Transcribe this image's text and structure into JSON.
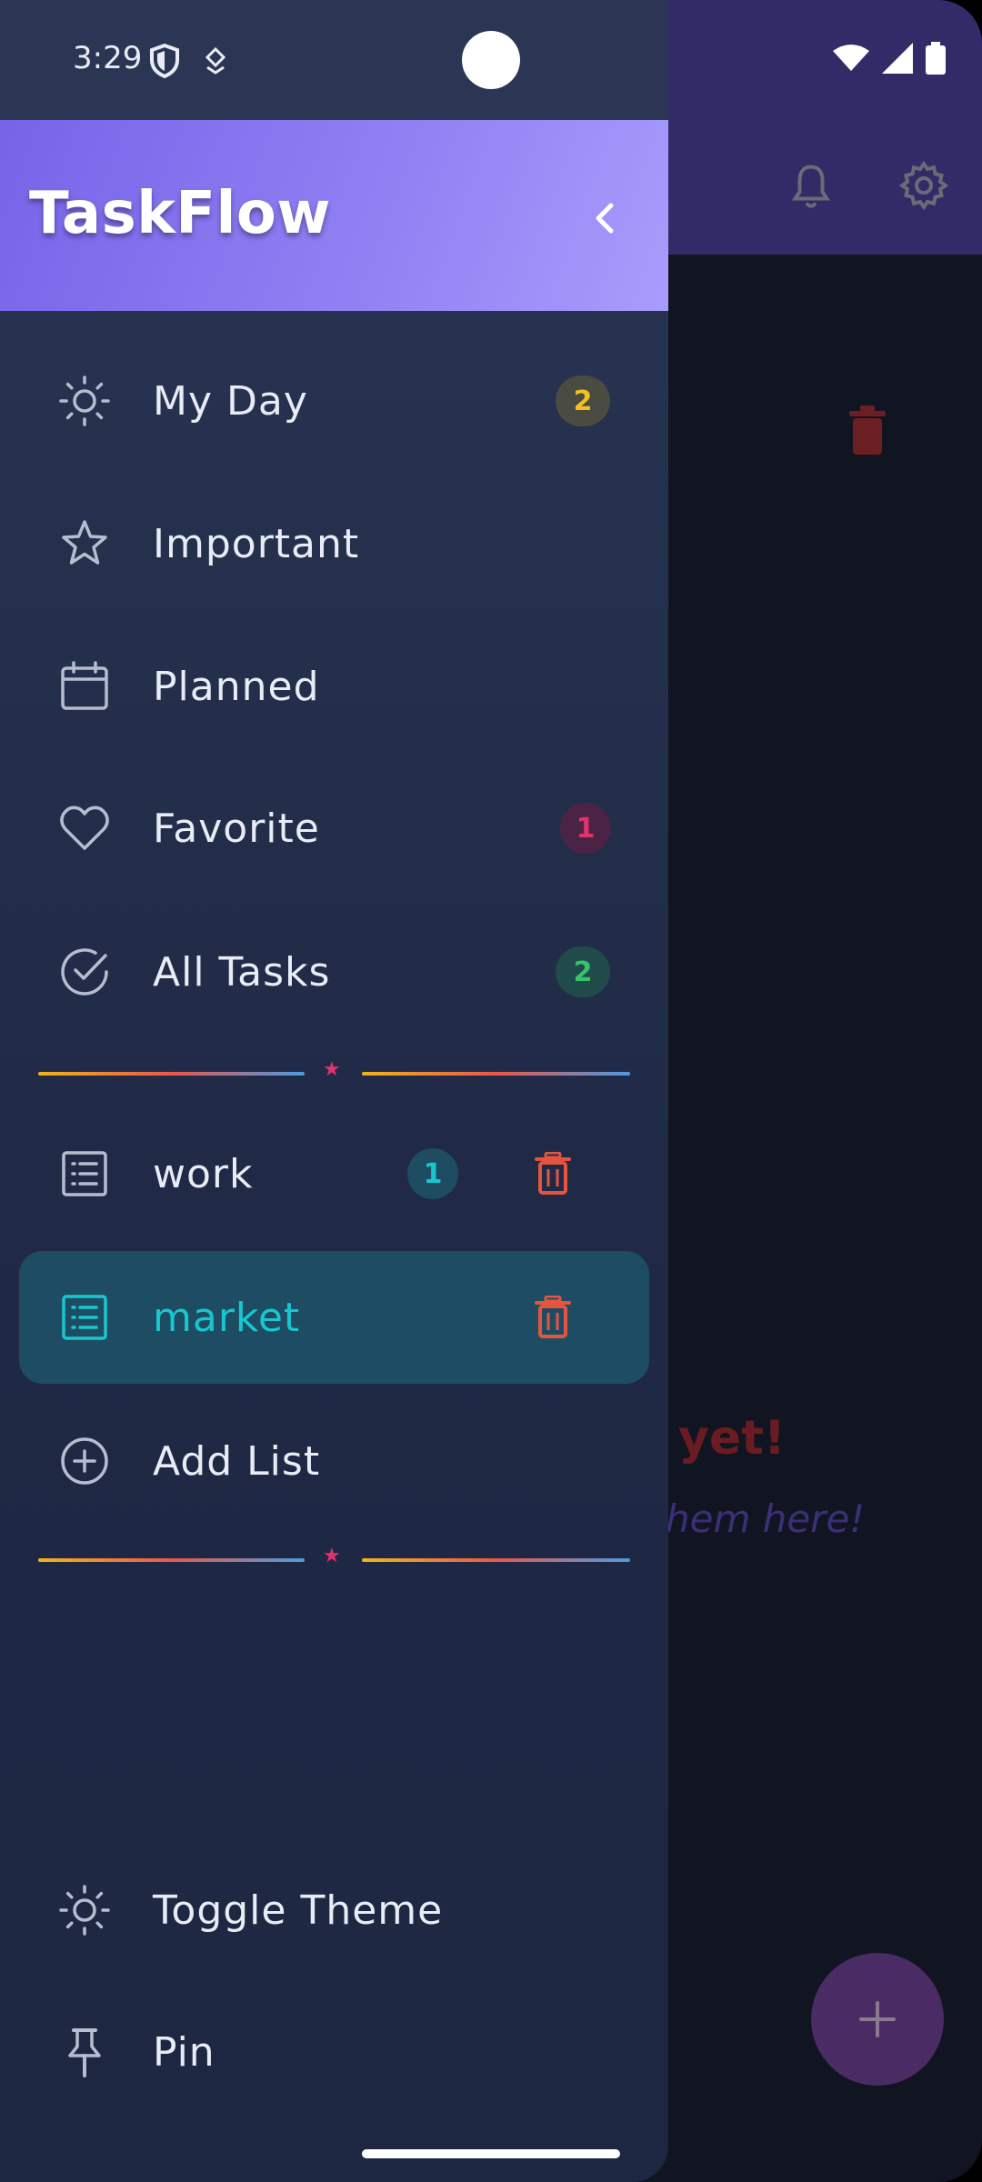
{
  "status_bar": {
    "time": "3:29"
  },
  "header": {
    "title": "TaskFlow"
  },
  "nav": {
    "my_day": {
      "label": "My Day",
      "count": "2"
    },
    "important": {
      "label": "Important"
    },
    "planned": {
      "label": "Planned"
    },
    "favorite": {
      "label": "Favorite",
      "count": "1"
    },
    "all_tasks": {
      "label": "All Tasks",
      "count": "2"
    }
  },
  "lists": [
    {
      "label": "work",
      "count": "1",
      "selected": false
    },
    {
      "label": "market",
      "selected": true
    }
  ],
  "add_list": {
    "label": "Add List"
  },
  "footer": {
    "toggle_theme": {
      "label": "Toggle Theme"
    },
    "pin": {
      "label": "Pin"
    }
  },
  "background": {
    "empty_title": "yet!",
    "empty_subtitle": "hem here!"
  },
  "colors": {
    "header_gradient_start": "#7664e8",
    "header_gradient_end": "#a89cfb",
    "accent_teal": "#19c6cf",
    "danger": "#e5543f",
    "badge_yellow": "#f3c022",
    "badge_pink": "#e0336c",
    "badge_green": "#35c46a",
    "selected_bg": "#1e4d63"
  }
}
